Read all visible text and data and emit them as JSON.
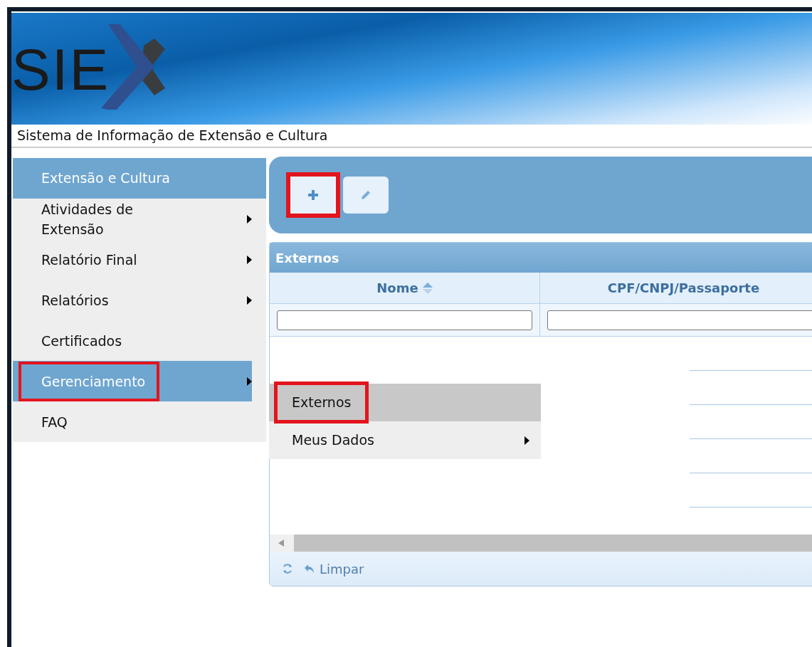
{
  "header": {
    "logo_text": "SIE",
    "subtitle": "Sistema de Informação de Extensão e Cultura"
  },
  "sidebar": {
    "title": "Extensão e Cultura",
    "items": [
      {
        "label": "Atividades de Extensão",
        "has_submenu": true,
        "selected": false,
        "highlighted": false
      },
      {
        "label": "Relatório Final",
        "has_submenu": true,
        "selected": false,
        "highlighted": false
      },
      {
        "label": "Relatórios",
        "has_submenu": true,
        "selected": false,
        "highlighted": false
      },
      {
        "label": "Certificados",
        "has_submenu": false,
        "selected": false,
        "highlighted": false
      },
      {
        "label": "Gerenciamento",
        "has_submenu": true,
        "selected": true,
        "highlighted": true
      },
      {
        "label": "FAQ",
        "has_submenu": false,
        "selected": false,
        "highlighted": false
      }
    ]
  },
  "submenu": {
    "items": [
      {
        "label": "Externos",
        "has_submenu": false,
        "selected": true,
        "highlighted": true
      },
      {
        "label": "Meus Dados",
        "has_submenu": true,
        "selected": false,
        "highlighted": false
      }
    ]
  },
  "toolbar": {
    "buttons": [
      {
        "kind": "add",
        "highlighted": true
      },
      {
        "kind": "edit",
        "highlighted": false
      }
    ]
  },
  "grid": {
    "title": "Externos",
    "columns": [
      {
        "label": "Nome",
        "sorted": true
      },
      {
        "label": "CPF/CNPJ/Passaporte",
        "sorted": false
      }
    ],
    "footer": {
      "clear_label": "Limpar"
    }
  }
}
